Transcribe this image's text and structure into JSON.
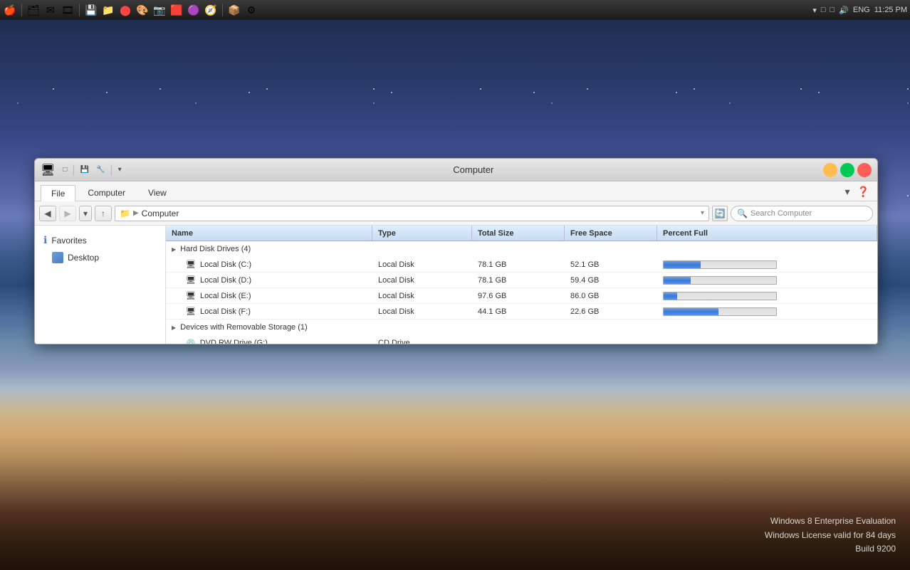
{
  "taskbar": {
    "icons": [
      {
        "name": "apple-menu",
        "symbol": "🍎"
      },
      {
        "name": "finder",
        "symbol": "🗂"
      },
      {
        "name": "mail",
        "symbol": "✉"
      },
      {
        "name": "video",
        "symbol": "🎬"
      },
      {
        "name": "separator1"
      },
      {
        "name": "disk-util",
        "symbol": "💾"
      },
      {
        "name": "app1",
        "symbol": "🔲"
      },
      {
        "name": "opera",
        "symbol": "🔴"
      },
      {
        "name": "photoshop",
        "symbol": "🎨"
      },
      {
        "name": "app2",
        "symbol": "📷"
      },
      {
        "name": "app3",
        "symbol": "🟥"
      },
      {
        "name": "app4",
        "symbol": "🟣"
      },
      {
        "name": "safari",
        "symbol": "🧭"
      },
      {
        "name": "separator2"
      },
      {
        "name": "app5",
        "symbol": "📦"
      },
      {
        "name": "app6",
        "symbol": "⚙"
      }
    ],
    "right": {
      "dropdown_icon": "▾",
      "sys1": "□",
      "sys2": "□",
      "volume": "🔊",
      "language": "ENG",
      "time": "11:25 PM"
    }
  },
  "window": {
    "title": "Computer",
    "tabs": [
      {
        "label": "File",
        "active": true
      },
      {
        "label": "Computer",
        "active": false
      },
      {
        "label": "View",
        "active": false
      }
    ],
    "nav": {
      "back_disabled": false,
      "forward_disabled": true,
      "up_label": "↑",
      "address_icon": "🖥",
      "address_text": "Computer",
      "search_placeholder": "Search Computer"
    },
    "sidebar": {
      "items": [
        {
          "label": "Favorites",
          "type": "favorites"
        },
        {
          "label": "Desktop",
          "type": "desktop"
        }
      ]
    },
    "columns": [
      {
        "label": "Name"
      },
      {
        "label": "Type"
      },
      {
        "label": "Total Size"
      },
      {
        "label": "Free Space"
      },
      {
        "label": "Percent Full"
      }
    ],
    "sections": [
      {
        "label": "Hard Disk Drives (4)",
        "drives": [
          {
            "name": "Local Disk (C:)",
            "type": "Local Disk",
            "total": "78.1 GB",
            "free": "52.1 GB",
            "percent_used": 33
          },
          {
            "name": "Local Disk (D:)",
            "type": "Local Disk",
            "total": "78.1 GB",
            "free": "59.4 GB",
            "percent_used": 24
          },
          {
            "name": "Local Disk (E:)",
            "type": "Local Disk",
            "total": "97.6 GB",
            "free": "86.0 GB",
            "percent_used": 12
          },
          {
            "name": "Local Disk (F:)",
            "type": "Local Disk",
            "total": "44.1 GB",
            "free": "22.6 GB",
            "percent_used": 49
          }
        ]
      },
      {
        "label": "Devices with Removable Storage (1)",
        "drives": [
          {
            "name": "DVD RW Drive (G:)",
            "type": "CD Drive",
            "total": "",
            "free": "",
            "percent_used": 0
          }
        ]
      }
    ]
  },
  "watermark": {
    "line1": "Windows 8 Enterprise Evaluation",
    "line2": "Windows License valid for 84 days",
    "line3": "Build 9200"
  }
}
